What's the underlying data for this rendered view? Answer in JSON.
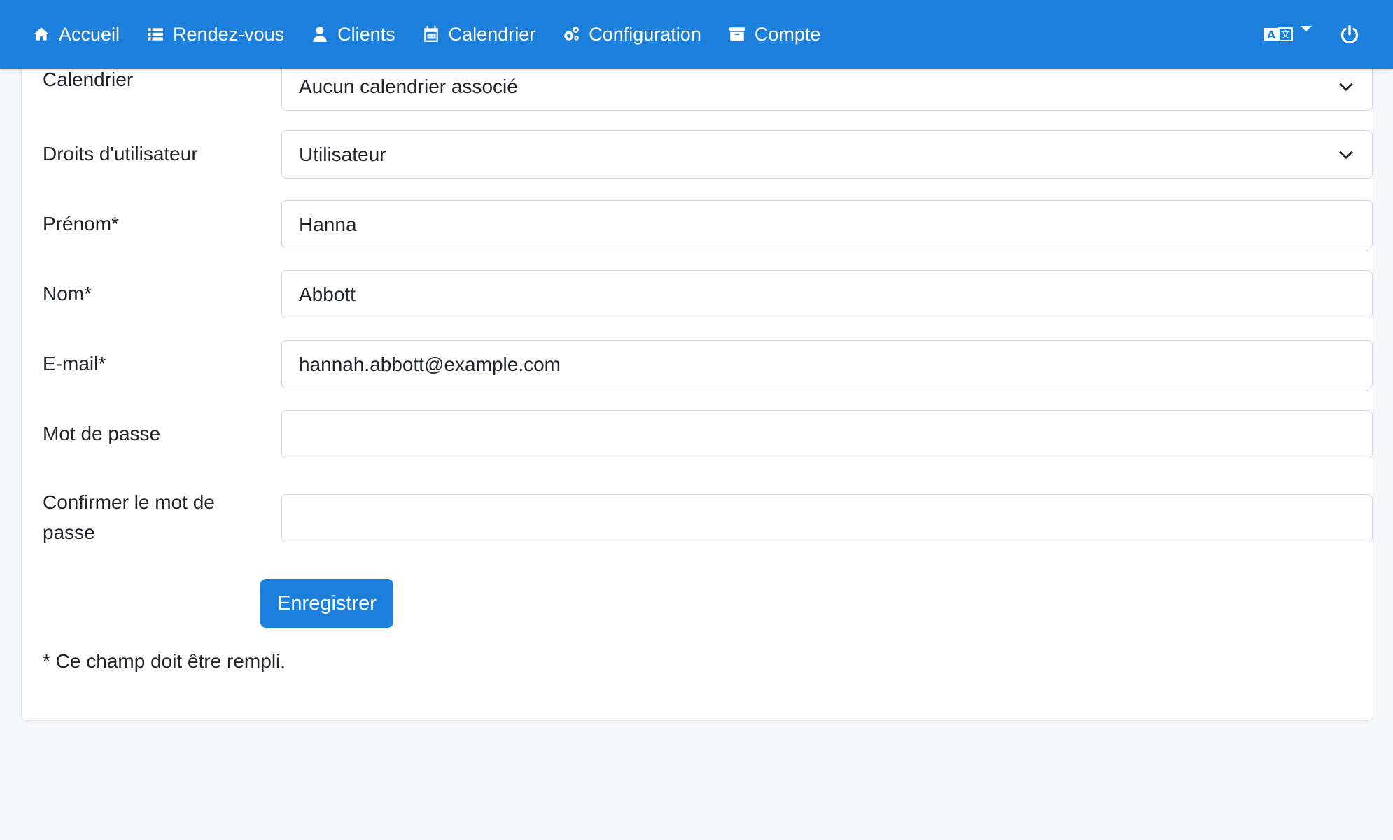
{
  "nav": {
    "items": [
      {
        "label": "Accueil",
        "icon": "home-icon"
      },
      {
        "label": "Rendez-vous",
        "icon": "list-icon"
      },
      {
        "label": "Clients",
        "icon": "user-icon"
      },
      {
        "label": "Calendrier",
        "icon": "calendar-icon"
      },
      {
        "label": "Configuration",
        "icon": "cogs-icon"
      },
      {
        "label": "Compte",
        "icon": "archive-icon"
      }
    ],
    "language_icon": "language-icon",
    "logout_icon": "power-icon"
  },
  "form": {
    "calendar": {
      "label": "Calendrier",
      "value": "Aucun calendrier associé"
    },
    "rights": {
      "label": "Droits d'utilisateur",
      "value": "Utilisateur"
    },
    "firstname": {
      "label": "Prénom*",
      "value": "Hanna"
    },
    "lastname": {
      "label": "Nom*",
      "value": "Abbott"
    },
    "email": {
      "label": "E-mail*",
      "value": "hannah.abbott@example.com"
    },
    "password": {
      "label": "Mot de passe",
      "value": ""
    },
    "password_confirm": {
      "label": "Confirmer le mot de passe",
      "value": ""
    },
    "save_label": "Enregistrer",
    "required_note": "* Ce champ doit être rempli."
  },
  "colors": {
    "primary": "#1c7fdb",
    "page_background": "#f6f8fb",
    "card_background": "#ffffff",
    "input_border": "#d4d9df"
  }
}
